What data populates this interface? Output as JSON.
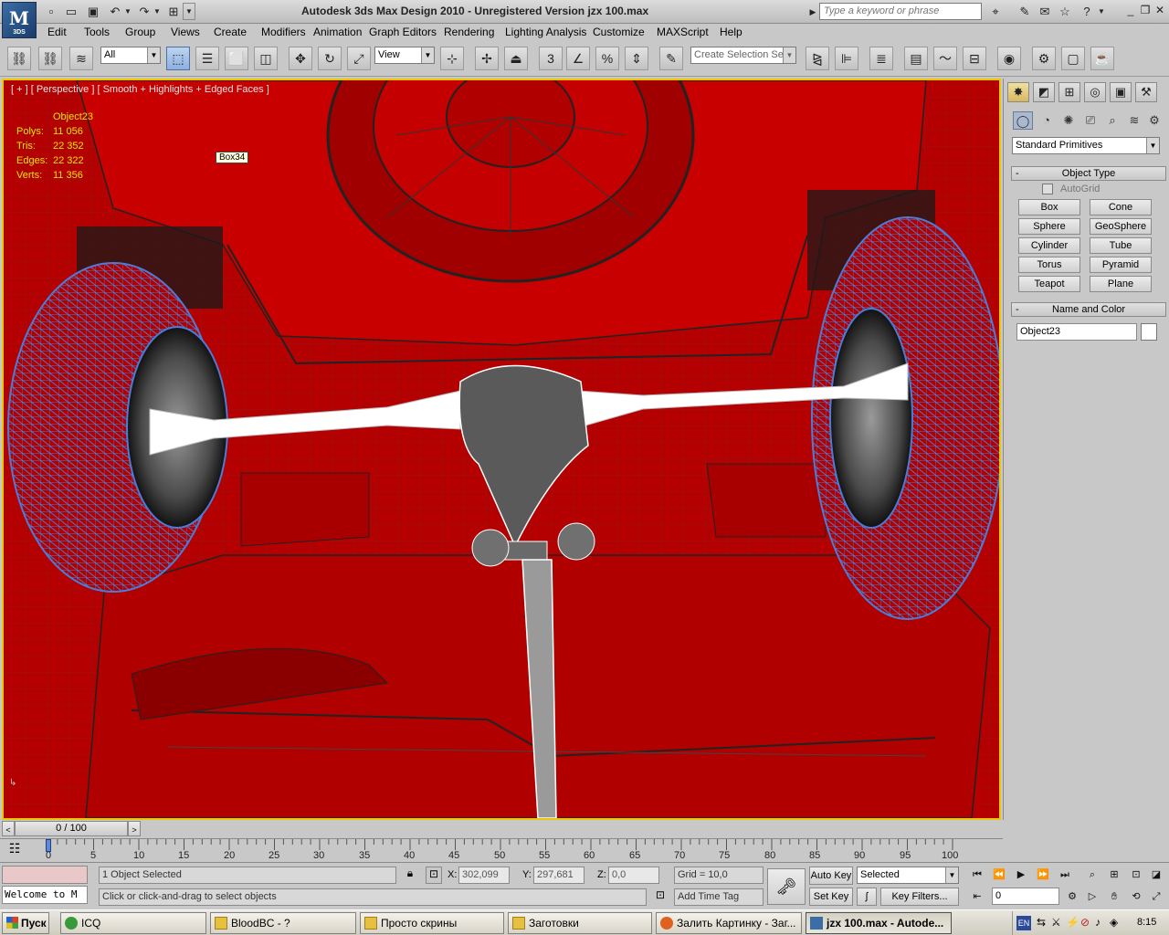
{
  "app": {
    "logo_text": "M",
    "logo_sub": "3DS",
    "title": "Autodesk 3ds Max Design 2010  - Unregistered Version    jzx 100.max",
    "search_placeholder": "Type a keyword or phrase"
  },
  "menu": [
    "Edit",
    "Tools",
    "Group",
    "Views",
    "Create",
    "Modifiers",
    "Animation",
    "Graph Editors",
    "Rendering",
    "Lighting Analysis",
    "Customize",
    "MAXScript",
    "Help"
  ],
  "toolbar": {
    "filter_value": "All",
    "ref_coord_value": "View",
    "selection_set_placeholder": "Create Selection Se",
    "snap_label": "3",
    "percent_snap_label": "%"
  },
  "viewport": {
    "label": "[ + ] [ Perspective ] [ Smooth + Highlights + Edged Faces ]",
    "stats": {
      "object": "Object23",
      "rows": [
        {
          "k": "Polys:",
          "v": "11 056"
        },
        {
          "k": "Tris:",
          "v": "22 352"
        },
        {
          "k": "Edges:",
          "v": "22 322"
        },
        {
          "k": "Verts:",
          "v": "11 356"
        }
      ]
    },
    "tooltip": "Box34",
    "colors": {
      "body": "#b80000",
      "wheel": "#4a7cd8",
      "shaft": "#ffffff"
    }
  },
  "command_panel": {
    "category_dropdown": "Standard Primitives",
    "object_type_title": "Object Type",
    "autogrid_label": "AutoGrid",
    "primitives": [
      "Box",
      "Cone",
      "Sphere",
      "GeoSphere",
      "Cylinder",
      "Tube",
      "Torus",
      "Pyramid",
      "Teapot",
      "Plane"
    ],
    "name_color_title": "Name and Color",
    "object_name": "Object23",
    "rollout_minus": "-"
  },
  "timeline": {
    "frame_readout": "0 / 100",
    "ticks": [
      "0",
      "5",
      "10",
      "15",
      "20",
      "25",
      "30",
      "35",
      "40",
      "45",
      "50",
      "55",
      "60",
      "65",
      "70",
      "75",
      "80",
      "85",
      "90",
      "95",
      "100"
    ]
  },
  "status": {
    "script_listener": "Welcome to M",
    "selection_info": "1 Object Selected",
    "prompt": "Click or click-and-drag to select objects",
    "x_label": "X:",
    "x_value": "302,099",
    "y_label": "Y:",
    "y_value": "297,681",
    "z_label": "Z:",
    "z_value": "0,0",
    "grid": "Grid = 10,0",
    "add_time_tag": "Add Time Tag",
    "auto_key": "Auto Key",
    "set_key": "Set Key",
    "key_mode": "Selected",
    "key_filters": "Key Filters...",
    "current_frame": "0"
  },
  "taskbar": {
    "start": "Пуск",
    "tasks": [
      {
        "label": "ICQ",
        "color": "#3a9a3a"
      },
      {
        "label": "BloodBC - ?",
        "color": "#e8c040"
      },
      {
        "label": "Просто скрины",
        "color": "#e8c040"
      },
      {
        "label": "Заготовки",
        "color": "#e8c040"
      },
      {
        "label": "Залить Картинку - Заг...",
        "color": "#e06020"
      },
      {
        "label": "jzx 100.max - Autode...",
        "color": "#3a6ea5"
      }
    ],
    "lang": "EN",
    "clock": "8:15"
  }
}
